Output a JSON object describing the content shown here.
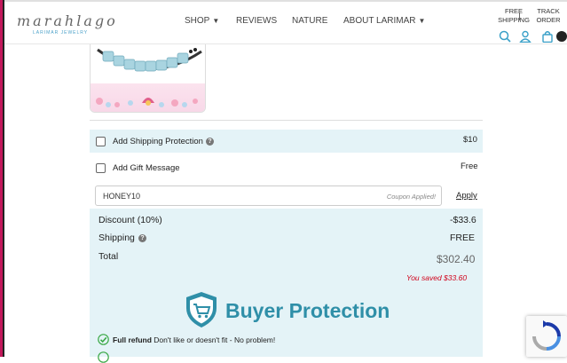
{
  "header": {
    "logo_text": "marahlago",
    "logo_subtitle": "LARIMAR JEWELRY",
    "nav": [
      {
        "label": "SHOP",
        "has_caret": true
      },
      {
        "label": "REVIEWS",
        "has_caret": false
      },
      {
        "label": "NATURE",
        "has_caret": false
      },
      {
        "label": "ABOUT LARIMAR",
        "has_caret": true
      }
    ],
    "free_shipping": [
      "FREE",
      "SHIPPING"
    ],
    "track_order": [
      "TRACK",
      "ORDER"
    ],
    "caret_glyph": "▼",
    "icons": [
      "search-icon",
      "account-icon",
      "cart-icon"
    ]
  },
  "options": {
    "shipping_protection": {
      "label": "Add Shipping Protection",
      "help": "?",
      "price": "$10",
      "checked": false
    },
    "gift_message": {
      "label": "Add Gift Message",
      "price": "Free",
      "checked": false
    }
  },
  "coupon": {
    "value": "HONEY10",
    "note": "Coupon Applied!",
    "apply_label": "Apply"
  },
  "summary": {
    "discount_label": "Discount (10%)",
    "discount_value": "-$33.6",
    "shipping_label": "Shipping",
    "shipping_help": "?",
    "shipping_value": "FREE",
    "total_label": "Total",
    "total_value": "$302.40",
    "saved_text": "You saved $33.60"
  },
  "buyer_protection": {
    "title": "Buyer Protection",
    "refund_bold": "Full refund",
    "refund_text": "Don't like or doesn't fit - No problem!"
  },
  "colors": {
    "accent": "#2f8fa8",
    "panel": "#e4f3f7",
    "saved": "#d0021b",
    "check": "#3aa845"
  }
}
